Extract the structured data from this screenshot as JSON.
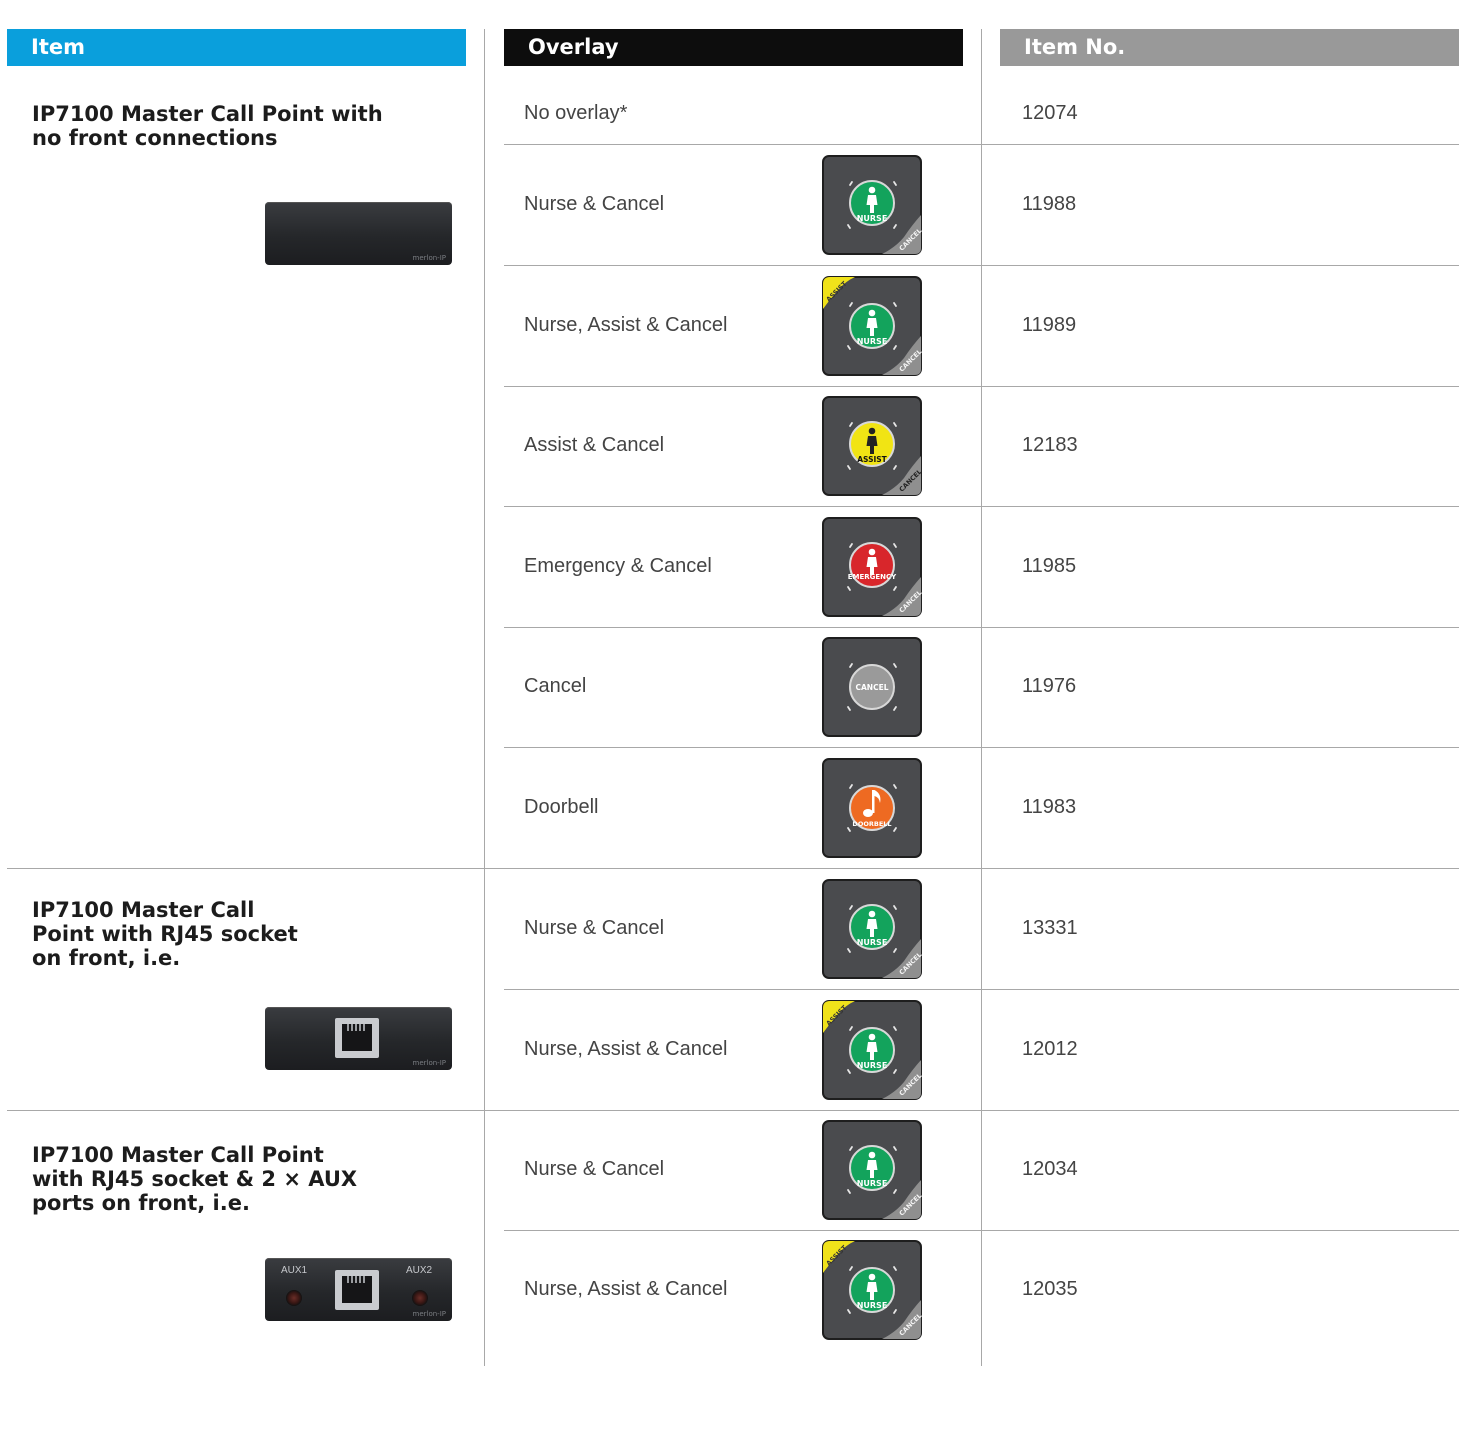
{
  "headers": {
    "item": "Item",
    "overlay": "Overlay",
    "item_no": "Item No.",
    "colors": {
      "item": "#0a9fdc",
      "overlay": "#0d0d0d",
      "item_no": "#999999"
    }
  },
  "groups": [
    {
      "title": [
        "IP7100 Master Call Point with",
        "no front connections"
      ],
      "plate_brand": "merlon-IP"
    },
    {
      "title": [
        "IP7100 Master Call",
        "Point with RJ45 socket",
        "on front, i.e."
      ],
      "plate_brand": "merlon-IP"
    },
    {
      "title": [
        "IP7100 Master Call Point",
        "with RJ45 socket & 2 × AUX",
        "ports on front, i.e."
      ],
      "plate_brand": "merlon-IP",
      "aux_labels": [
        "AUX1",
        "AUX2"
      ]
    }
  ],
  "rows": [
    {
      "overlay": "No overlay*",
      "item_no": "12074",
      "icon": "none"
    },
    {
      "overlay": "Nurse & Cancel",
      "item_no": "11988",
      "icon": "nurse-cancel-overlay-icon"
    },
    {
      "overlay": "Nurse, Assist & Cancel",
      "item_no": "11989",
      "icon": "nurse-assist-cancel-overlay-icon"
    },
    {
      "overlay": "Assist & Cancel",
      "item_no": "12183",
      "icon": "assist-cancel-overlay-icon"
    },
    {
      "overlay": "Emergency & Cancel",
      "item_no": "11985",
      "icon": "emergency-cancel-overlay-icon"
    },
    {
      "overlay": "Cancel",
      "item_no": "11976",
      "icon": "cancel-overlay-icon"
    },
    {
      "overlay": "Doorbell",
      "item_no": "11983",
      "icon": "doorbell-overlay-icon"
    },
    {
      "overlay": "Nurse & Cancel",
      "item_no": "13331",
      "icon": "nurse-cancel-overlay-icon"
    },
    {
      "overlay": "Nurse, Assist & Cancel",
      "item_no": "12012",
      "icon": "nurse-assist-cancel-overlay-icon"
    },
    {
      "overlay": "Nurse & Cancel",
      "item_no": "12034",
      "icon": "nurse-cancel-overlay-icon"
    },
    {
      "overlay": "Nurse, Assist & Cancel",
      "item_no": "12035",
      "icon": "nurse-assist-cancel-overlay-icon"
    }
  ],
  "button_texts": {
    "nurse": "NURSE",
    "assist": "ASSIST",
    "cancel": "CANCEL",
    "emergency": "EMERGENCY",
    "doorbell": "DOORBELL"
  }
}
